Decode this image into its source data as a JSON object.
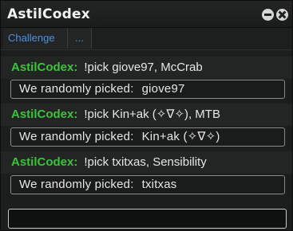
{
  "window": {
    "title": "AstilCodex",
    "minimize_icon": "minimize-icon",
    "close_icon": "close-icon"
  },
  "tabs": [
    {
      "label": "Challenge"
    },
    {
      "label": "..."
    }
  ],
  "messages": [
    {
      "user": "AstilCodex:",
      "command": "!pick giove97, McCrab",
      "reply_prefix": "We randomly picked:",
      "reply_value": "giove97"
    },
    {
      "user": "AstilCodex:",
      "command": "!pick Kin+ak (✧∇✧), MTB",
      "reply_prefix": "We randomly picked:",
      "reply_value": "Kin+ak (✧∇✧)"
    },
    {
      "user": "AstilCodex:",
      "command": "!pick txitxas, Sensibility",
      "reply_prefix": "We randomly picked:",
      "reply_value": "txitxas"
    }
  ],
  "input": {
    "value": "",
    "placeholder": ""
  },
  "colors": {
    "username": "#3cc23c",
    "tab_link": "#4f8fe0",
    "window_bg": "#1e1f1f"
  }
}
